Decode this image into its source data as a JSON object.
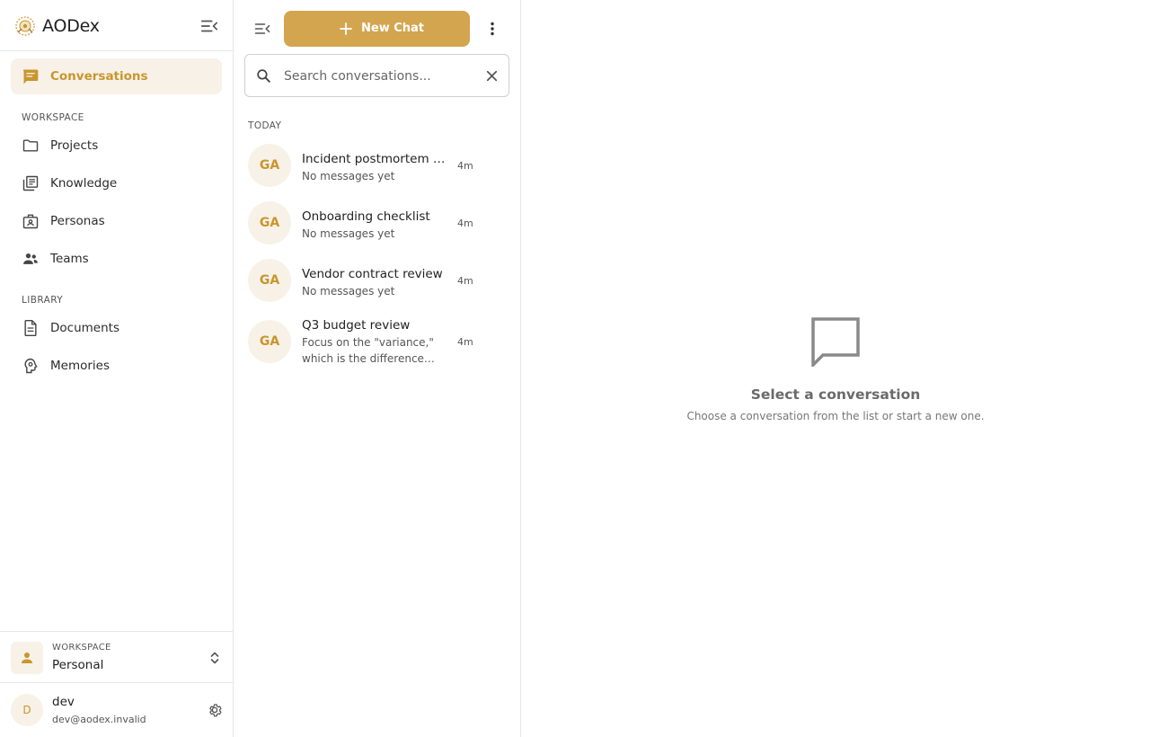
{
  "app": {
    "name": "AODex"
  },
  "colors": {
    "accent": "#c8962e",
    "button": "#d4a54f",
    "active_bg": "#f8f1e7",
    "border": "#e6e6e6"
  },
  "sidebar": {
    "active_item": {
      "label": "Conversations",
      "icon": "chat-bubble-icon"
    },
    "sections": [
      {
        "title": "WORKSPACE",
        "items": [
          {
            "label": "Projects",
            "icon": "folder-icon"
          },
          {
            "label": "Knowledge",
            "icon": "library-icon"
          },
          {
            "label": "Personas",
            "icon": "persona-badge-icon"
          },
          {
            "label": "Teams",
            "icon": "people-icon"
          }
        ]
      },
      {
        "title": "LIBRARY",
        "items": [
          {
            "label": "Documents",
            "icon": "document-icon"
          },
          {
            "label": "Memories",
            "icon": "brain-icon"
          }
        ]
      }
    ],
    "workspace": {
      "caption": "WORKSPACE",
      "name": "Personal"
    },
    "user": {
      "initial": "D",
      "name": "dev",
      "email": "dev@aodex.invalid"
    }
  },
  "list": {
    "new_chat_label": "New Chat",
    "search_placeholder": "Search conversations...",
    "group_label": "TODAY",
    "conversations": [
      {
        "initials": "GA",
        "title": "Incident postmortem …",
        "preview": "No messages yet",
        "time": "4m"
      },
      {
        "initials": "GA",
        "title": "Onboarding checklist",
        "preview": "No messages yet",
        "time": "4m"
      },
      {
        "initials": "GA",
        "title": "Vendor contract review",
        "preview": "No messages yet",
        "time": "4m"
      },
      {
        "initials": "GA",
        "title": "Q3 budget review",
        "preview": "Focus on the \"variance,\" which is the difference b…",
        "time": "4m"
      }
    ]
  },
  "empty_state": {
    "title": "Select a conversation",
    "subtitle": "Choose a conversation from the list or start a new one."
  }
}
